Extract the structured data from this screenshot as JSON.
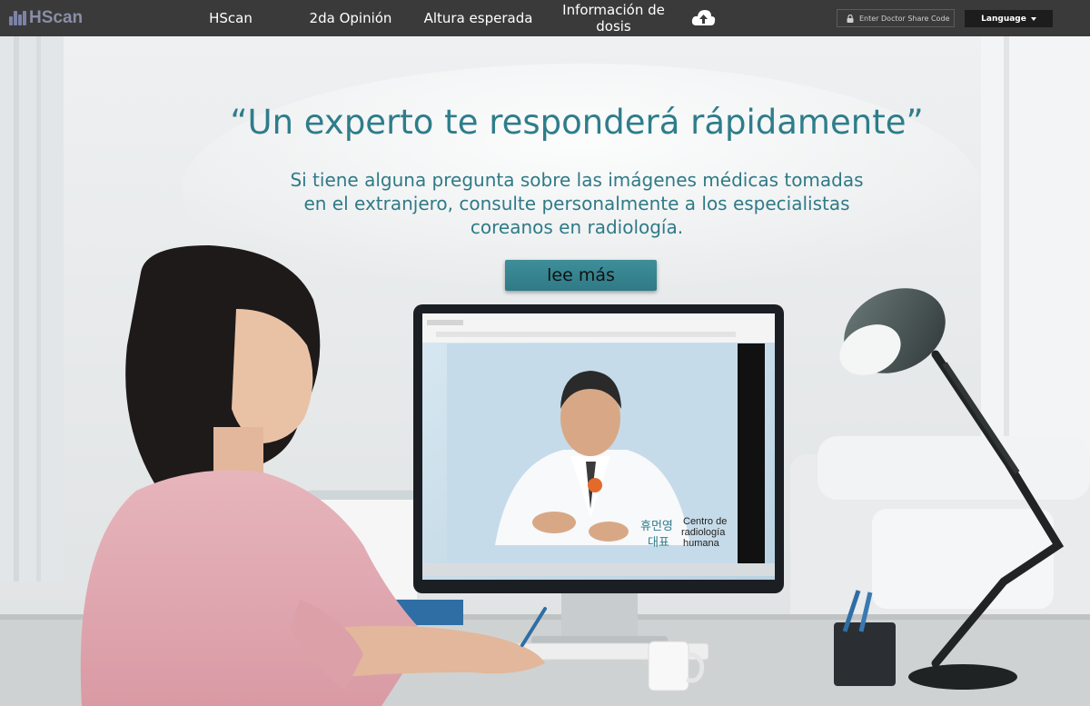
{
  "brand": {
    "name": "HScan"
  },
  "nav": {
    "items": [
      {
        "label": "HScan"
      },
      {
        "label": "2da Opinión"
      },
      {
        "label": "Altura esperada"
      },
      {
        "label": "Información de dosis"
      }
    ],
    "upload_icon": "cloud-upload-icon",
    "share_code_placeholder": "Enter Doctor Share Code",
    "lock_icon": "lock-icon",
    "language_label": "Language",
    "language_caret_icon": "caret-down-icon"
  },
  "hero": {
    "title": "“Un experto te responderá rápidamente”",
    "subtitle": "Si tiene alguna pregunta sobre las imágenes médicas tomadas en el extranjero, consulte personalmente a los especialistas coreanos en radiología.",
    "button_label": "lee más"
  },
  "monitor": {
    "caption_line1": "Centro de",
    "caption_line2": "radiología",
    "caption_line3": "humana",
    "korean_line1": "휴먼영",
    "korean_line2": "대표"
  },
  "colors": {
    "nav_background": "#3a3a3a",
    "accent_teal": "#2e7d8a",
    "button_teal": "#3a8894",
    "language_background": "#1d1d1d"
  }
}
